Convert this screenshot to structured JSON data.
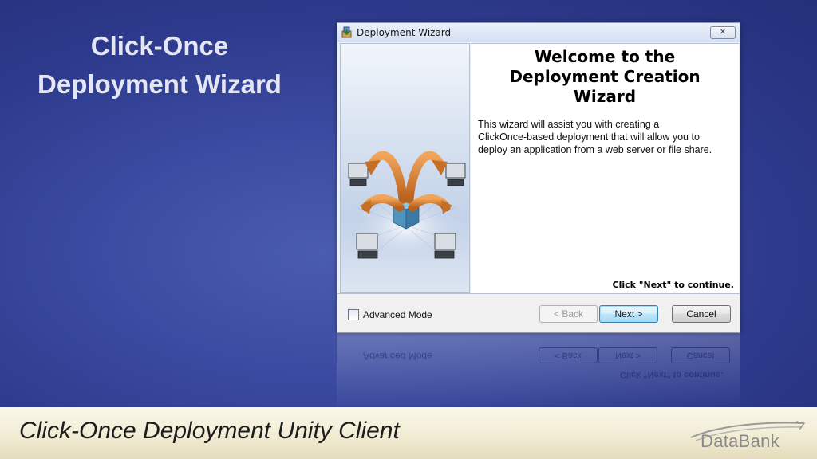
{
  "slide": {
    "title_line1": "Click-Once",
    "title_line2": "Deployment Wizard",
    "footer_text": "Click-Once Deployment Unity Client",
    "logo_text": "DataBank"
  },
  "dialog": {
    "title": "Deployment Wizard",
    "close_glyph": "✕",
    "welcome_line1": "Welcome to the",
    "welcome_line2": "Deployment Creation",
    "welcome_line3": "Wizard",
    "desc_line1": "This wizard will assist you with creating a",
    "desc_line2": "ClickOnce-based deployment that will allow you to",
    "desc_line3": "deploy an application from a web server or file share.",
    "continue_hint": "Click \"Next\" to continue.",
    "advanced_mode_label": "Advanced Mode",
    "advanced_mode_checked": false,
    "back_label": "< Back",
    "next_label": "Next >",
    "cancel_label": "Cancel"
  },
  "icons": {
    "app": "installer-icon",
    "close": "close-icon",
    "illustration": "deployment-arrows-illustration"
  },
  "colors": {
    "background": "#3a4aa0",
    "footer": "#f1ecd4",
    "arrow": "#d8843a",
    "package": "#5aa0c8"
  }
}
